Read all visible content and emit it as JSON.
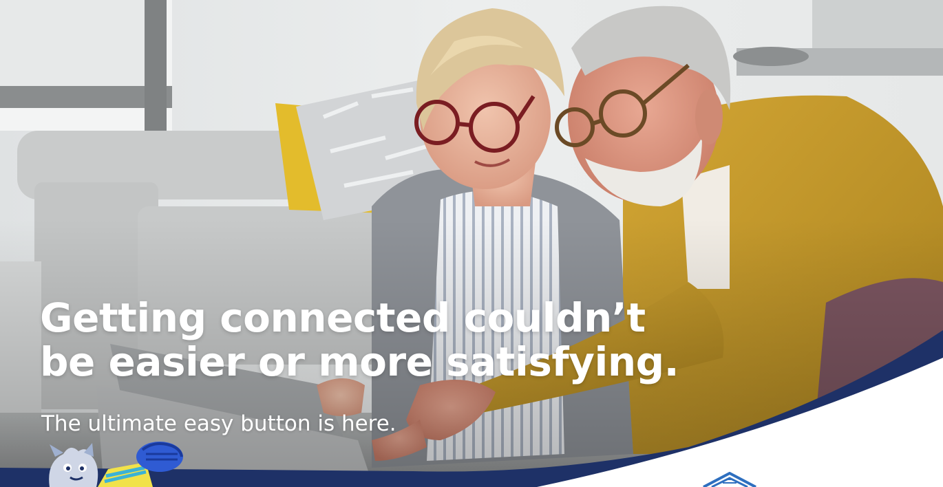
{
  "hero": {
    "headline_line1": "Getting connected couldn’t",
    "headline_line2": "be easier or more satisfying.",
    "subheadline": "The ultimate easy button is here."
  },
  "colors": {
    "text": "#ffffff",
    "brand_navy": "#1e3167",
    "sweater_mustard": "#c29a2b",
    "pillow_yellow": "#e3bc2c"
  },
  "icons": {
    "mascot": "mascot-icon",
    "brand_logo": "roof-logo-icon"
  }
}
